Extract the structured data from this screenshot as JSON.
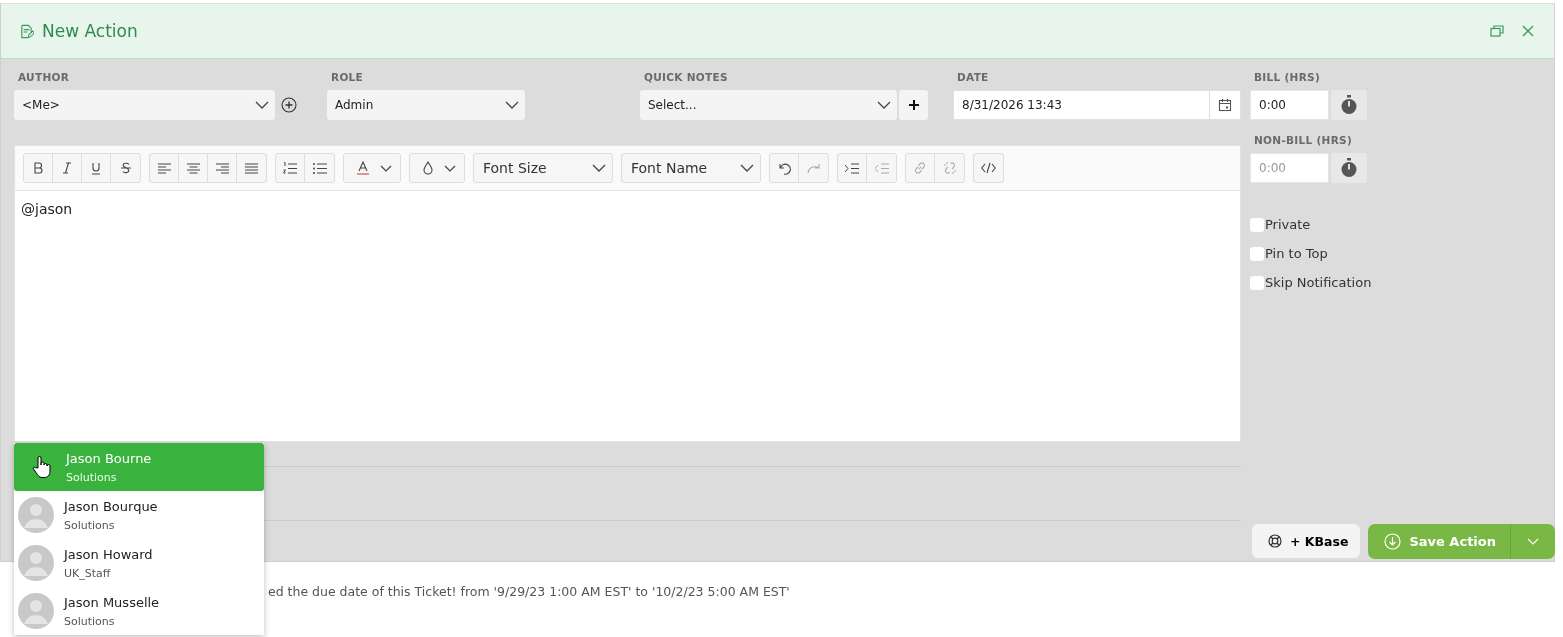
{
  "dialog": {
    "title": "New Action"
  },
  "fields": [
    {
      "kind": "author",
      "label": "AUTHOR",
      "value": "<Me>"
    },
    {
      "kind": "select",
      "label": "ROLE",
      "value": "Admin"
    },
    {
      "kind": "notes",
      "label": "QUICK NOTES",
      "value": "Select..."
    },
    {
      "kind": "date",
      "label": "DATE",
      "value": "8/31/2026 13:43"
    }
  ],
  "hours": [
    {
      "label": "BILL (HRS)",
      "value": "0:00"
    },
    {
      "label": "NON-BILL (HRS)",
      "placeholder": "0:00"
    }
  ],
  "toolbar": {
    "font_size": "Font Size",
    "font_name": "Font Name"
  },
  "editor": {
    "value": "@jason"
  },
  "options": [
    {
      "label": "Private",
      "checked": false
    },
    {
      "label": "Pin to Top",
      "checked": false
    },
    {
      "label": "Skip Notification",
      "checked": false
    }
  ],
  "mentions": [
    {
      "name": "Jason Bourne",
      "team": "Solutions",
      "selected": true
    },
    {
      "name": "Jason Bourque",
      "team": "Solutions",
      "selected": false
    },
    {
      "name": "Jason Howard",
      "team": "UK_Staff",
      "selected": false
    },
    {
      "name": "Jason Musselle",
      "team": "Solutions",
      "selected": false
    }
  ],
  "buttons": {
    "kbase": "+ KBase",
    "save": "Save Action"
  },
  "activity": [
    "ed the due date of this Ticket! from '9/29/23 1:00 AM EST' to '10/2/23 5:00 AM EST'"
  ]
}
